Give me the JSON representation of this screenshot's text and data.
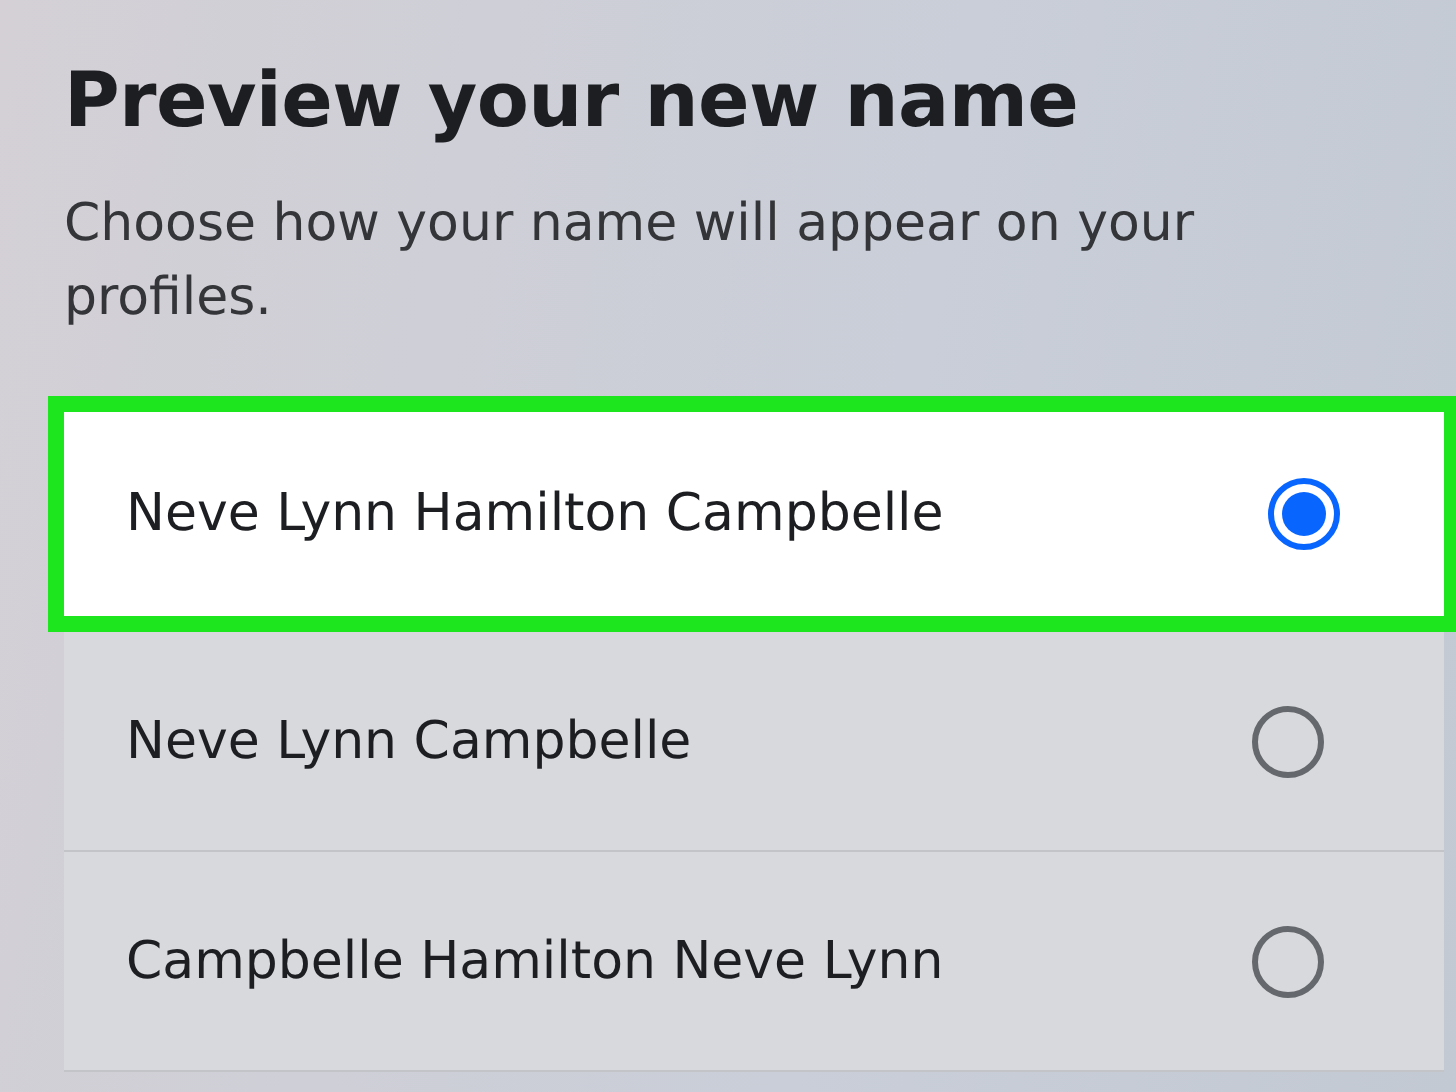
{
  "title": "Preview your new name",
  "description": "Choose how your name will appear on your profiles.",
  "options": [
    {
      "label": "Neve Lynn Hamilton Campbelle",
      "selected": true,
      "highlighted": true
    },
    {
      "label": "Neve Lynn Campbelle",
      "selected": false,
      "highlighted": false
    },
    {
      "label": "Campbelle Hamilton Neve Lynn",
      "selected": false,
      "highlighted": false
    }
  ]
}
